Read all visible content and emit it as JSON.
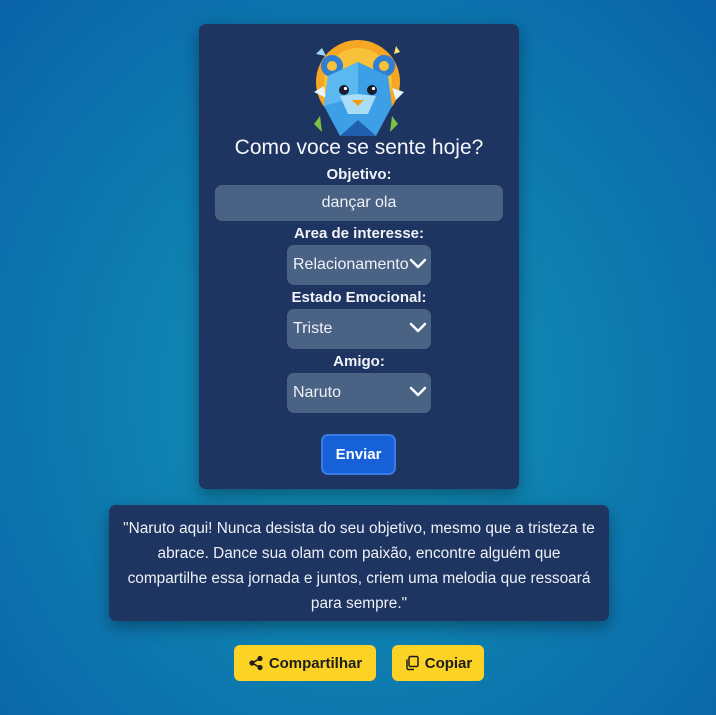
{
  "form": {
    "title": "Como voce se sente hoje?",
    "objective_label": "Objetivo:",
    "objective_value": "dançar ola",
    "area_label": "Area de interesse:",
    "area_value": "Relacionamento",
    "emotion_label": "Estado Emocional:",
    "emotion_value": "Triste",
    "friend_label": "Amigo:",
    "friend_value": "Naruto",
    "send_label": "Enviar"
  },
  "response": {
    "text": "\"Naruto aqui! Nunca desista do seu objetivo, mesmo que a tristeza te abrace. Dance sua olam com paixão, encontre alguém que compartilhe essa jornada e juntos, criem uma melodia que ressoará para sempre.\""
  },
  "actions": {
    "share_label": "Compartilhar",
    "copy_label": "Copiar"
  },
  "icons": {
    "logo": "bear-mascot-logo",
    "chevron": "chevron-down-icon",
    "share": "share-icon",
    "copy": "copy-icon"
  },
  "colors": {
    "card": "#1e3461",
    "input": "#4a6284",
    "primary": "#1660d8",
    "action": "#fcd224"
  }
}
